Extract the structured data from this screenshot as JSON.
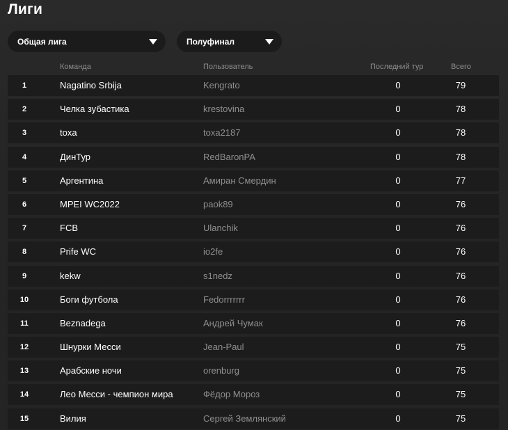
{
  "page": {
    "title": "Лиги"
  },
  "filters": {
    "league": "Общая лига",
    "stage": "Полуфинал"
  },
  "table": {
    "columns": {
      "team": "Команда",
      "user": "Пользователь",
      "last_round": "Последний тур",
      "total": "Всего"
    },
    "rows": [
      {
        "rank": "1",
        "team": "Nagatino Srbija",
        "user": "Kengrato",
        "last": "0",
        "total": "79"
      },
      {
        "rank": "2",
        "team": "Челка зубастика",
        "user": "krestovina",
        "last": "0",
        "total": "78"
      },
      {
        "rank": "3",
        "team": "toxa",
        "user": "toxa2187",
        "last": "0",
        "total": "78"
      },
      {
        "rank": "4",
        "team": "ДинТур",
        "user": "RedBaronPA",
        "last": "0",
        "total": "78"
      },
      {
        "rank": "5",
        "team": "Аргентина",
        "user": "Амиран Смердин",
        "last": "0",
        "total": "77"
      },
      {
        "rank": "6",
        "team": "MPEI WC2022",
        "user": "paok89",
        "last": "0",
        "total": "76"
      },
      {
        "rank": "7",
        "team": "FCB",
        "user": "Ulanchik",
        "last": "0",
        "total": "76"
      },
      {
        "rank": "8",
        "team": "Prife WC",
        "user": "io2fe",
        "last": "0",
        "total": "76"
      },
      {
        "rank": "9",
        "team": "kekw",
        "user": "s1nedz",
        "last": "0",
        "total": "76"
      },
      {
        "rank": "10",
        "team": "Боги футбола",
        "user": "Fedorrrrrrr",
        "last": "0",
        "total": "76"
      },
      {
        "rank": "11",
        "team": "Beznadega",
        "user": "Андрей Чумак",
        "last": "0",
        "total": "76"
      },
      {
        "rank": "12",
        "team": "Шнурки Месси",
        "user": "Jean-Paul",
        "last": "0",
        "total": "75"
      },
      {
        "rank": "13",
        "team": "Арабские ночи",
        "user": "orenburg",
        "last": "0",
        "total": "75"
      },
      {
        "rank": "14",
        "team": "Лео Месси - чемпион мира",
        "user": "Фёдор Мороз",
        "last": "0",
        "total": "75"
      },
      {
        "rank": "15",
        "team": "Вилия",
        "user": "Сергей Землянский",
        "last": "0",
        "total": "75"
      }
    ]
  }
}
